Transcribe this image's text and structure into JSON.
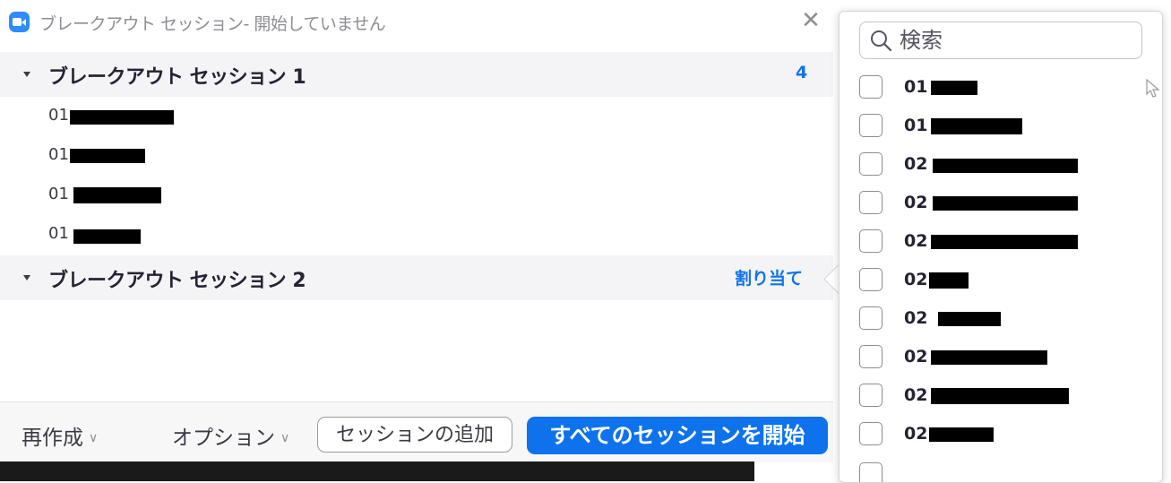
{
  "window": {
    "title": "ブレークアウト セッション- 開始していません",
    "close_label": "✕"
  },
  "sessions": [
    {
      "name": "ブレークアウト セッション 1",
      "count": "4",
      "members": [
        "01",
        "01",
        "01",
        "01"
      ]
    },
    {
      "name": "ブレークアウト セッション 2",
      "assign_label": "割り当て"
    }
  ],
  "footer": {
    "recreate_label": "再作成",
    "options_label": "オプション",
    "add_session_label": "セッションの追加",
    "start_all_label": "すべてのセッションを開始"
  },
  "assign_popup": {
    "search_placeholder": "検索",
    "participants": [
      {
        "prefix": "01",
        "checked": false
      },
      {
        "prefix": "01",
        "checked": false
      },
      {
        "prefix": "02",
        "checked": false
      },
      {
        "prefix": "02",
        "checked": false
      },
      {
        "prefix": "02",
        "checked": false
      },
      {
        "prefix": "02",
        "checked": false
      },
      {
        "prefix": "02",
        "checked": false
      },
      {
        "prefix": "02",
        "checked": false
      },
      {
        "prefix": "02",
        "checked": false
      },
      {
        "prefix": "02",
        "checked": false
      }
    ]
  },
  "colors": {
    "accent": "#0e72ed",
    "header_bg": "#f4f4f6",
    "redaction": "#000000"
  }
}
